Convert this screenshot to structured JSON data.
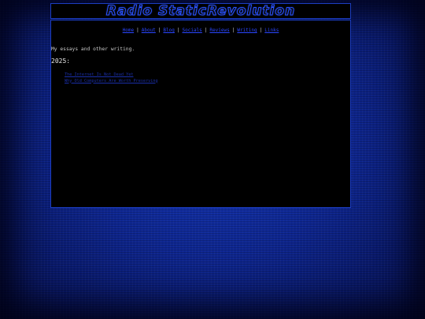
{
  "banner": {
    "title": "Radio StaticRevolution"
  },
  "nav": {
    "items": [
      {
        "label": "Home"
      },
      {
        "label": "About"
      },
      {
        "label": "Blog"
      },
      {
        "label": "Socials"
      },
      {
        "label": "Reviews"
      },
      {
        "label": "Writing"
      },
      {
        "label": "Links"
      }
    ],
    "separator": "|"
  },
  "content": {
    "intro": "My essays and other writing.",
    "year_heading": "2025:",
    "essays": [
      {
        "title": "The Internet Is Not Dead Yet"
      },
      {
        "title": "Why Old Computers Are Worth Preserving"
      }
    ]
  },
  "colors": {
    "background": "#0e2690",
    "panel": "#000000",
    "link": "#2a46ff",
    "border": "#1c3dc0"
  }
}
